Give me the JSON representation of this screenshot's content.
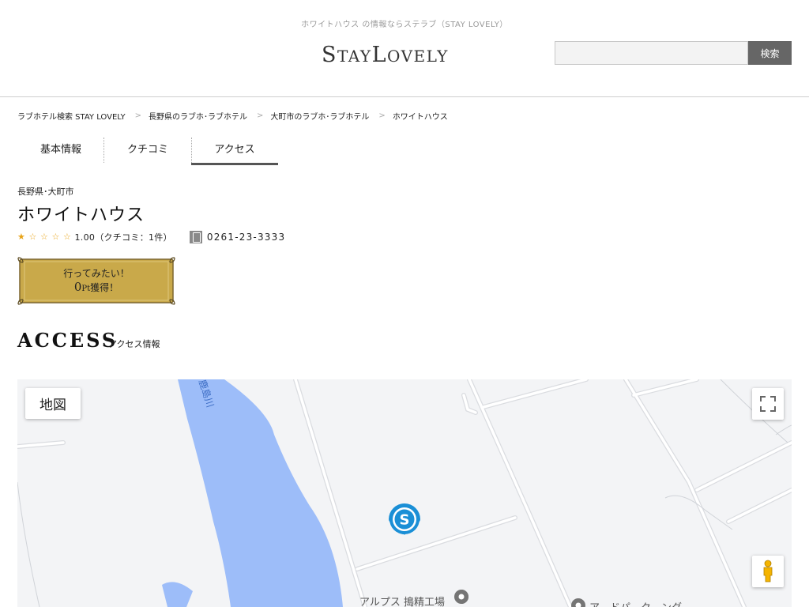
{
  "header": {
    "tagline": "ホワイトハウス の情報ならステラブ（STAY LOVELY）",
    "logo": "STAY LOVELY",
    "search": {
      "placeholder": "",
      "value": "",
      "button_label": "検索"
    }
  },
  "breadcrumb": [
    {
      "label": "ラブホテル検索 STAY LOVELY"
    },
    {
      "label": "長野県のラブホ･ラブホテル"
    },
    {
      "label": "大町市のラブホ･ラブホテル"
    },
    {
      "label": "ホワイトハウス"
    }
  ],
  "breadcrumb_separator": ">",
  "tabs": [
    {
      "label": "基本情報",
      "active": false
    },
    {
      "label": "クチコミ",
      "active": false
    },
    {
      "label": "アクセス",
      "active": true
    }
  ],
  "hotel": {
    "location": "長野県･大町市",
    "name": "ホワイトハウス",
    "rating": 1.0,
    "rating_max": 5,
    "rating_text": "1.00（クチコミ：1件）",
    "phone": "0261-23-3333",
    "phone_icon": "phone-icon"
  },
  "wish_button": {
    "line1": "行ってみたい！",
    "points": "0",
    "unit": "Pt",
    "line2_suffix": "獲得！",
    "colors": {
      "gold": "#c9a94a",
      "frame": "#8a7238"
    }
  },
  "access": {
    "title": "ACCESS",
    "subtitle": "アクセス情報"
  },
  "map": {
    "map_type_label": "地図",
    "river_label": "鹿島川",
    "place_label": "アルプス 搗精工場",
    "place_label_2": "ア…ドパ…ク…ング",
    "icons": [
      "fullscreen-icon",
      "pegman-icon",
      "hotel-marker-icon",
      "place-pin-icon"
    ],
    "colors": {
      "land": "#f3f4f6",
      "water": "#9dbdf9",
      "road": "#ffffff",
      "road_edge": "#dadce0",
      "marker": "#1a8fd6"
    }
  }
}
